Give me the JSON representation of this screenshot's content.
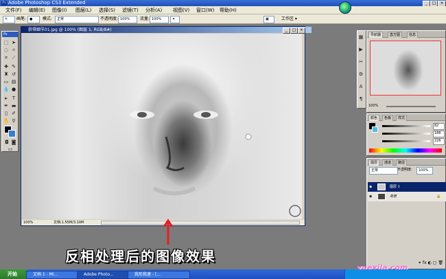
{
  "titlebar": {
    "title": "Adobe Photoshop CS3 Extended"
  },
  "menu": [
    "文件(F)",
    "编辑(E)",
    "图像(I)",
    "图层(L)",
    "选择(S)",
    "滤镜(T)",
    "分析(A)",
    "视图(V)",
    "窗口(W)",
    "帮助(H)"
  ],
  "options": {
    "brush_label": "画笔:",
    "mode_label": "模式:",
    "mode_value": "正常",
    "opacity_label": "不透明度:",
    "opacity_value": "100%",
    "flow_label": "流量:",
    "flow_value": "100%",
    "workspace_label": "工作区 ▾"
  },
  "toolbox": {
    "header": "Ps"
  },
  "document": {
    "title": "获得细节01.jpg @ 100% (图层 1, RGB/8#)",
    "zoom": "100%",
    "doc_info": "文档:1.55M/3.10M"
  },
  "navigator": {
    "tabs": [
      "导航器",
      "直方图",
      "信息"
    ],
    "zoom": "100%"
  },
  "color_panel": {
    "tabs": [
      "颜色",
      "色板",
      "样式"
    ],
    "r": "82",
    "g": "186",
    "b": "226"
  },
  "layers_panel": {
    "tabs": [
      "图层",
      "通道",
      "路径"
    ],
    "blend_mode": "正常",
    "opacity_label": "不透明度:",
    "opacity_value": "100%",
    "layers": [
      {
        "name": "图层 1"
      },
      {
        "name": "背景"
      }
    ]
  },
  "caption": "反相处理后的图像效果",
  "taskbar": {
    "start": "开始",
    "tasks": [
      "文档 1 - Mi...",
      "Adobe Photo...",
      "我形我速 - [..."
    ]
  },
  "watermark": "yuexila.com"
}
